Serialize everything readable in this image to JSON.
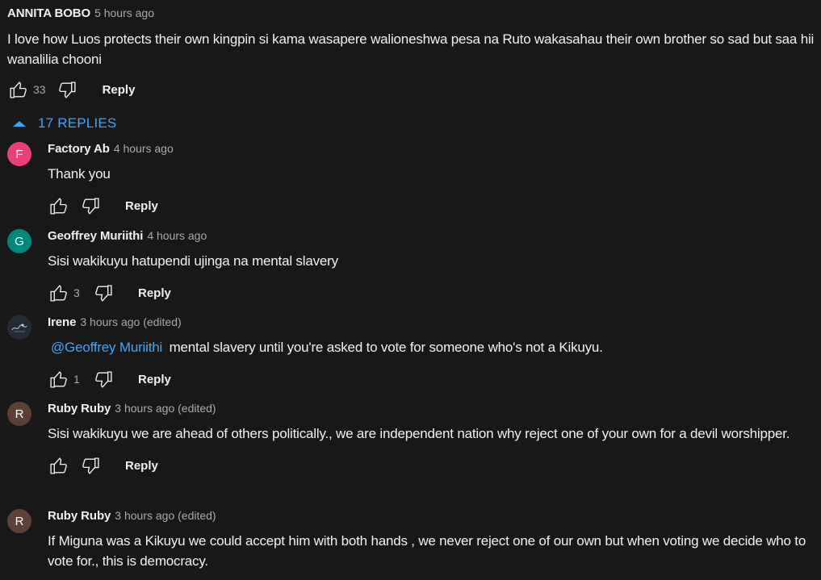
{
  "top_comment": {
    "author": "ANNITA BOBO",
    "time": "5 hours ago",
    "text": "I love how Luos protects their own kingpin si kama wasapere walioneshwa pesa na Ruto  wakasahau their own brother so sad but saa hii wanalilia chooni",
    "likes": "33",
    "reply_label": "Reply"
  },
  "replies_toggle": {
    "label": "17 REPLIES",
    "color": "#3ea6ff"
  },
  "replies": [
    {
      "avatar_letter": "F",
      "avatar_color": "#ec407a",
      "author": "Factory Ab",
      "time": "4 hours ago",
      "mention": "",
      "text": "Thank you",
      "likes": "",
      "reply_label": "Reply"
    },
    {
      "avatar_letter": "G",
      "avatar_color": "#00897b",
      "author": "Geoffrey Muriithi",
      "time": "4 hours ago",
      "mention": "",
      "text": "Sisi wakikuyu hatupendi ujinga na mental slavery",
      "likes": "3",
      "reply_label": "Reply"
    },
    {
      "avatar_letter": "",
      "avatar_color": "#2a2f3a",
      "author": "Irene",
      "time": "3 hours ago (edited)",
      "mention": "@Geoffrey Muriithi",
      "text": " mental slavery until you're asked to vote for someone who's not a Kikuyu.",
      "likes": "1",
      "reply_label": "Reply"
    },
    {
      "avatar_letter": "R",
      "avatar_color": "#5d4037",
      "author": "Ruby Ruby",
      "time": "3 hours ago (edited)",
      "mention": "",
      "text": "Sisi wakikuyu we are ahead of others politically., we are  independent nation why reject one of your own for a devil worshipper.",
      "likes": "",
      "reply_label": "Reply"
    },
    {
      "avatar_letter": "R",
      "avatar_color": "#5d4037",
      "author": "Ruby Ruby",
      "time": "3 hours ago (edited)",
      "mention": "",
      "text": "If Miguna was a Kikuyu we could accept him with both hands , we never reject  one of our own but when voting we decide who to vote for., this is democracy.",
      "likes": "",
      "reply_label": "Reply"
    }
  ],
  "icons": {
    "like": "thumbs-up-icon",
    "dislike": "thumbs-down-icon",
    "collapse": "caret-up-icon"
  }
}
